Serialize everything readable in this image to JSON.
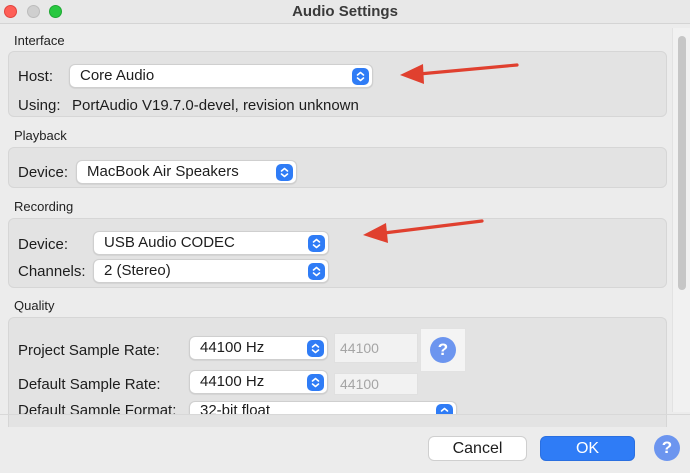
{
  "window": {
    "title": "Audio Settings"
  },
  "interface": {
    "section_label": "Interface",
    "host_label": "Host:",
    "host_value": "Core Audio",
    "using_label": "Using:",
    "using_value": "PortAudio V19.7.0-devel, revision unknown"
  },
  "playback": {
    "section_label": "Playback",
    "device_label": "Device:",
    "device_value": "MacBook Air Speakers"
  },
  "recording": {
    "section_label": "Recording",
    "device_label": "Device:",
    "device_value": "USB Audio CODEC",
    "channels_label": "Channels:",
    "channels_value": "2 (Stereo)"
  },
  "quality": {
    "section_label": "Quality",
    "project_rate_label": "Project Sample Rate:",
    "project_rate_value": "44100 Hz",
    "project_rate_custom": "44100",
    "default_rate_label": "Default Sample Rate:",
    "default_rate_value": "44100 Hz",
    "default_rate_custom": "44100",
    "default_format_label": "Default Sample Format:",
    "default_format_value": "32-bit float"
  },
  "buttons": {
    "cancel": "Cancel",
    "ok": "OK",
    "help": "?"
  },
  "colors": {
    "accent": "#2f7cf6",
    "annotation_arrow": "#e0402f"
  }
}
